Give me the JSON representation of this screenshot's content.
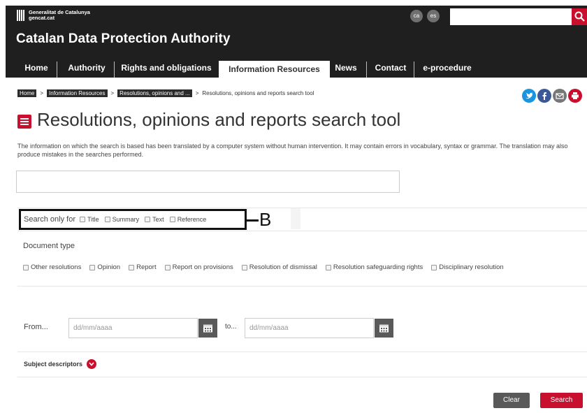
{
  "header": {
    "gencat_line1": "Generalitat de Catalunya",
    "gencat_line2": "gencat.cat",
    "languages": [
      "ca",
      "es"
    ],
    "search_placeholder": "",
    "site_title": "Catalan Data Protection Authority"
  },
  "nav": {
    "items": [
      {
        "label": "Home"
      },
      {
        "label": "Authority"
      },
      {
        "label": "Rights and obligations"
      },
      {
        "label": "Information Resources"
      },
      {
        "label": "News"
      },
      {
        "label": "Contact"
      },
      {
        "label": "e-procedure"
      }
    ],
    "active": "Information Resources"
  },
  "breadcrumb": {
    "items": [
      "Home",
      "Information Resources",
      "Resolutions, opinions and ..."
    ],
    "current": "Resolutions, opinions and reports search tool",
    "separator": ">"
  },
  "share_icons": [
    "twitter-icon",
    "facebook-icon",
    "mail-icon",
    "print-icon"
  ],
  "page": {
    "title": "Resolutions, opinions and reports search tool",
    "notice": "The information on which the search is based has been translated by a computer system without human intervention. It may contain errors in vocabulary, syntax or grammar. The translation may also produce mistakes in the searches performed.",
    "main_search_value": ""
  },
  "search_only_for": {
    "label": "Search only for",
    "options": [
      "Title",
      "Summary",
      "Text",
      "Reference"
    ],
    "marker": "B"
  },
  "document_type": {
    "label": "Document type",
    "options": [
      "Other resolutions",
      "Opinion",
      "Report",
      "Report on provisions",
      "Resolution of dismissal",
      "Resolution safeguarding rights",
      "Disciplinary resolution"
    ]
  },
  "dates": {
    "from_label": "From...",
    "to_label": "to...",
    "placeholder": "dd/mm/aaaa"
  },
  "subject": {
    "label": "Subject descriptors"
  },
  "buttons": {
    "clear": "Clear",
    "search": "Search"
  },
  "colors": {
    "header_bg": "#1f1f1f",
    "accent_red": "#c8102e",
    "button_grey": "#595959"
  }
}
